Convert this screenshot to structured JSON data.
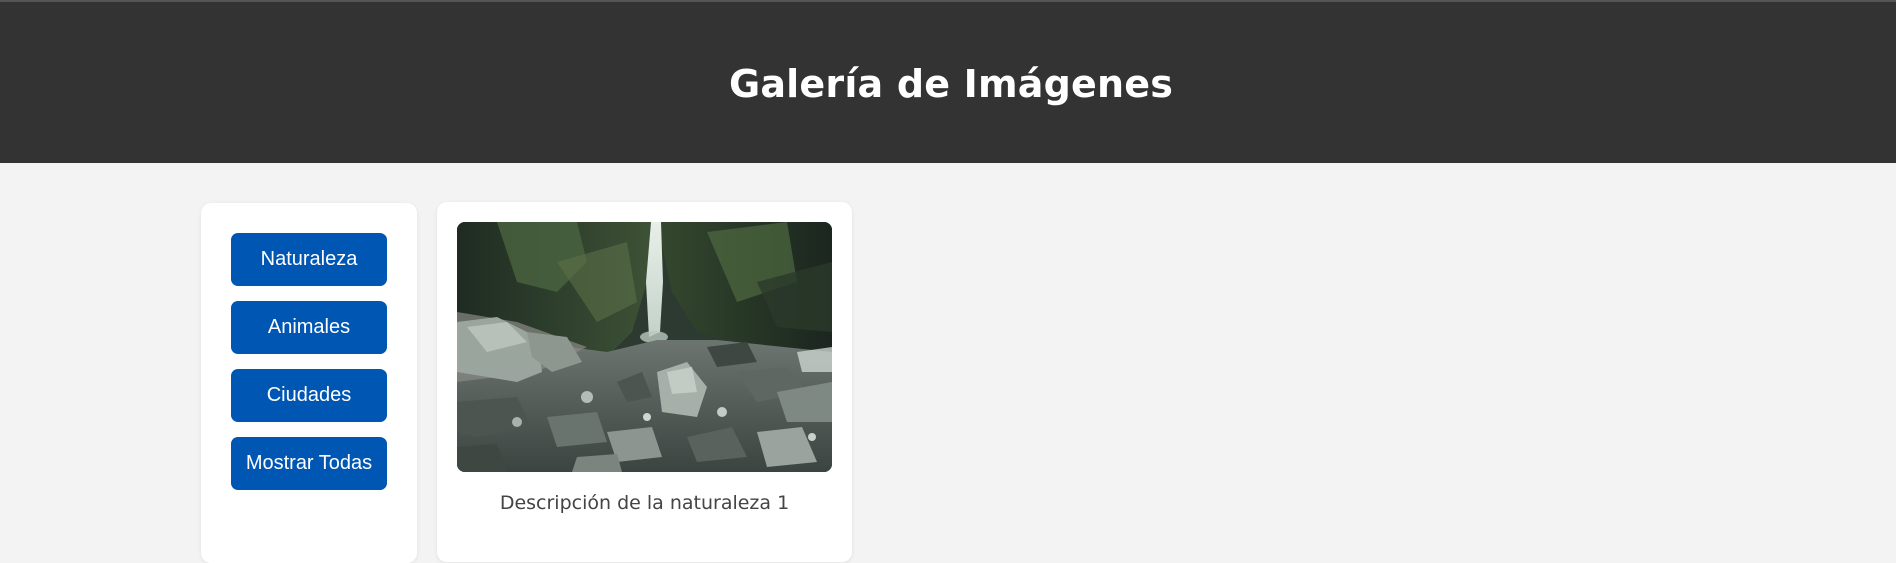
{
  "header": {
    "title": "Galería de Imágenes"
  },
  "filters": [
    {
      "label": "Naturaleza"
    },
    {
      "label": "Animales"
    },
    {
      "label": "Ciudades"
    },
    {
      "label": "Mostrar Todas"
    }
  ],
  "gallery": {
    "items": [
      {
        "image_subject": "waterfall-in-rocky-gorge",
        "caption": "Descripción de la naturaleza 1"
      }
    ]
  },
  "colors": {
    "header_bg": "#333333",
    "page_bg": "#f3f3f3",
    "button_bg": "#0056b3",
    "button_text": "#ffffff",
    "caption_text": "#444444"
  }
}
